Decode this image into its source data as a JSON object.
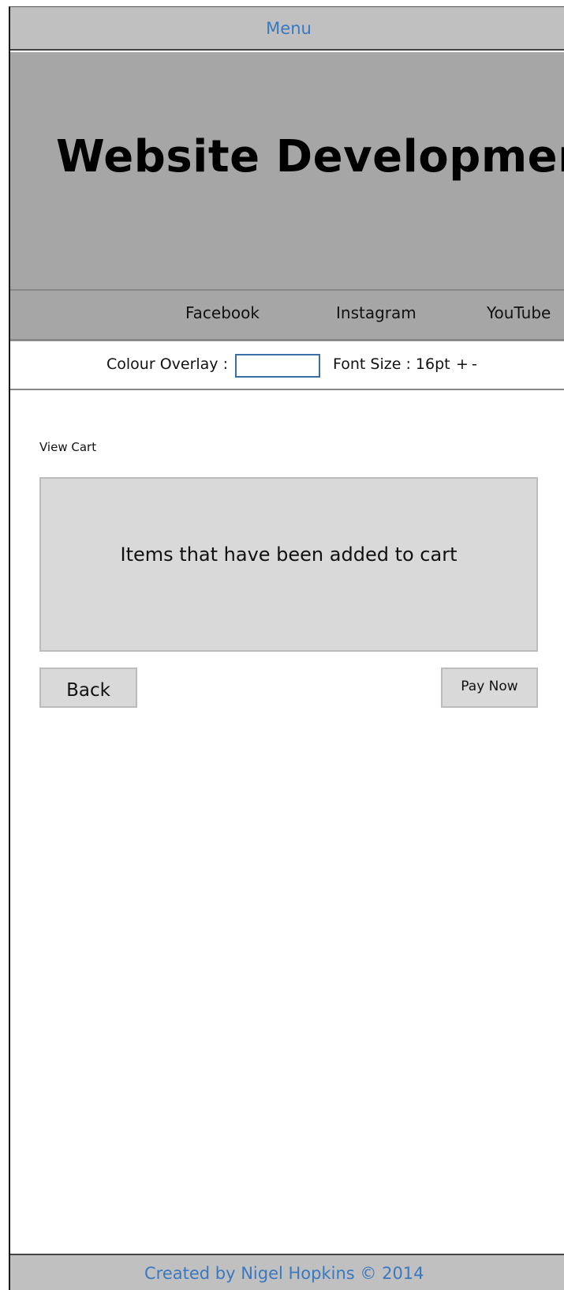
{
  "menu": {
    "label": "Menu"
  },
  "hero": {
    "title": "Website Development"
  },
  "social": {
    "items": [
      {
        "label": "Facebook"
      },
      {
        "label": "Instagram"
      },
      {
        "label": "YouTube"
      }
    ]
  },
  "accessibility": {
    "overlay_label": "Colour Overlay :",
    "overlay_value": "",
    "font_size_label": "Font Size : 16pt",
    "font_increase": "+",
    "font_decrease": "-"
  },
  "cart": {
    "heading": "View Cart",
    "items_text": "Items that have been added to cart"
  },
  "actions": {
    "back_label": "Back",
    "pay_label": "Pay Now"
  },
  "footer": {
    "text": "Created by Nigel Hopkins © 2014"
  },
  "colors": {
    "menu_bar": "#c0c0c0",
    "hero_bg": "#a6a6a6",
    "link_blue": "#3a78c0",
    "panel_bg": "#d9d9d9"
  }
}
